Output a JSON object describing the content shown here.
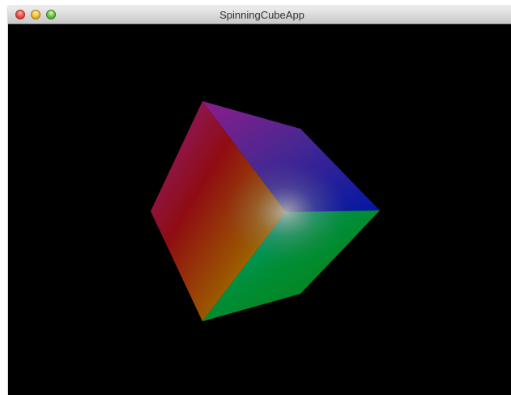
{
  "window": {
    "title": "SpinningCubeApp",
    "controls": {
      "close": "close-button",
      "minimize": "minimize-button",
      "zoom": "zoom-button"
    }
  },
  "scene": {
    "background": "#000000",
    "object": "spinning-cube",
    "face_colors": {
      "left": [
        "#8b0000",
        "#b8a000",
        "#cc22aa"
      ],
      "top": [
        "#8a1b8e",
        "#001a99"
      ],
      "right": [
        "#008800",
        "#00a8a8"
      ]
    }
  }
}
